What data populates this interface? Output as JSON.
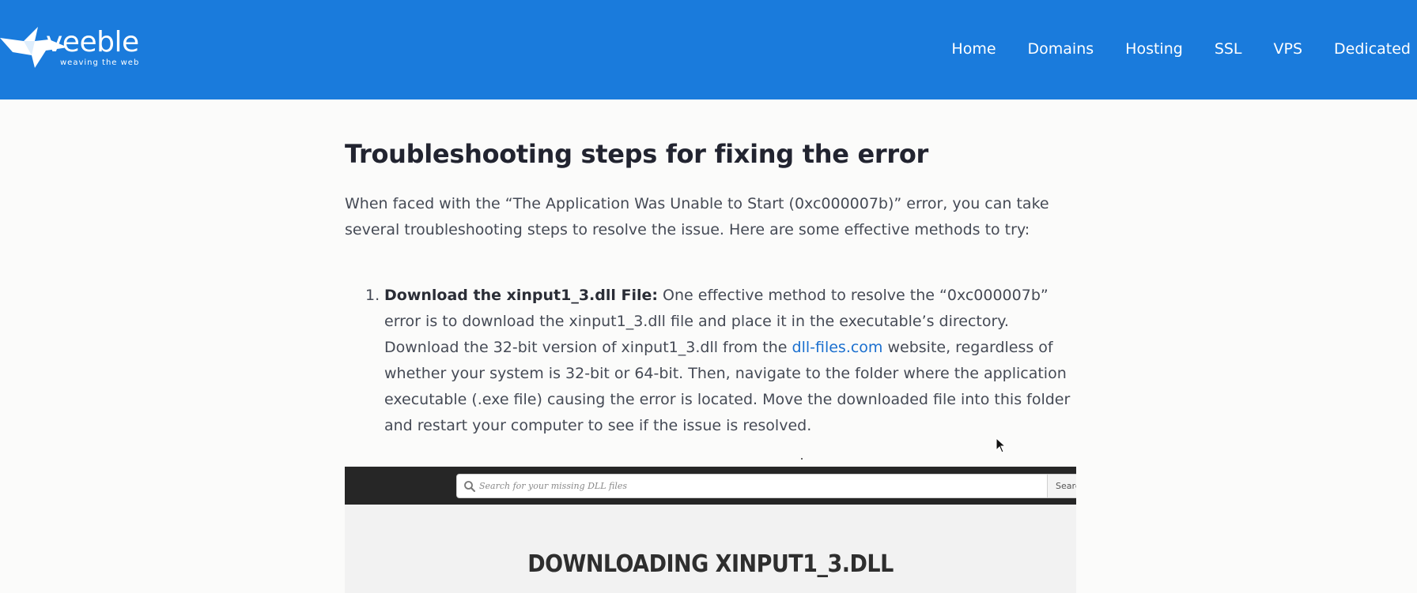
{
  "header": {
    "logo": {
      "name": "veeble",
      "tagline": "weaving the web"
    },
    "nav": [
      "Home",
      "Domains",
      "Hosting",
      "SSL",
      "VPS",
      "Dedicated"
    ],
    "background_color": "#1a7bdc"
  },
  "article": {
    "heading": "Troubleshooting steps for fixing the error",
    "lead": "When faced with the “The Application Was Unable to Start (0xc000007b)” error, you can take several troubleshooting steps to resolve the issue. Here are some effective methods to try:",
    "steps": [
      {
        "number": "1.",
        "title": "Download the xinput1_3.dll File:",
        "text_before_link": " One effective method to resolve the “0xc000007b” error is to download the xinput1_3.dll file and place it in the executable’s directory. Download the 32-bit version of xinput1_3.dll from the ",
        "link_text": "dll-files.com",
        "text_after_link": " website, regardless of whether your system is 32-bit or 64-bit. Then, navigate to the folder where the application executable (.exe file) causing the error is located. Move the downloaded file into this folder and restart your computer to see if the issue is resolved."
      }
    ]
  },
  "embed": {
    "search_placeholder": "Search for your missing DLL files",
    "search_button": "Search",
    "heading": "DOWNLOADING XINPUT1_3.DLL"
  },
  "icons": {
    "logo": "bird-logo-icon",
    "search": "search-icon",
    "cursor": "mouse-cursor-icon"
  },
  "colors": {
    "link": "#1a6fcf",
    "heading": "#222430",
    "body_text": "#454a55"
  }
}
